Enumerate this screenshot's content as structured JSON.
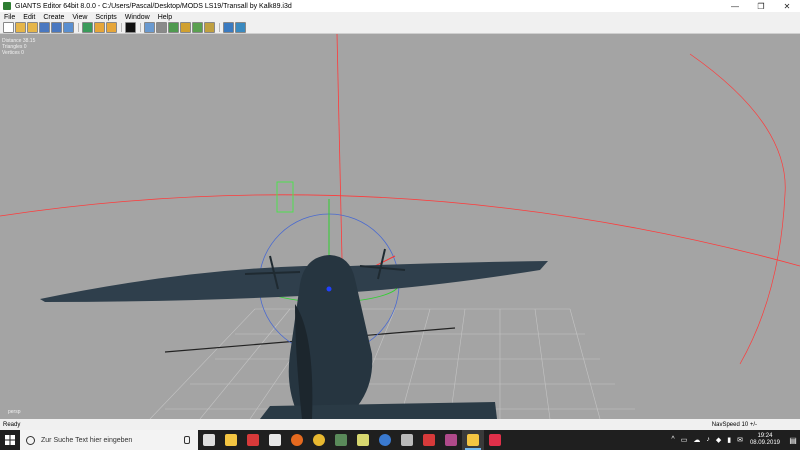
{
  "window": {
    "title": "GIANTS Editor 64bit 8.0.0 - C:/Users/Pascal/Desktop/MODS LS19/Transall by Kalk89.i3d"
  },
  "menu": [
    "File",
    "Edit",
    "Create",
    "View",
    "Scripts",
    "Window",
    "Help"
  ],
  "toolbar_icons": [
    {
      "name": "new-file-icon",
      "color": "#ffffff"
    },
    {
      "name": "open-folder-icon",
      "color": "#e6b64a"
    },
    {
      "name": "open-recent-icon",
      "color": "#e6b64a"
    },
    {
      "name": "save-icon",
      "color": "#4a78c0"
    },
    {
      "name": "save-as-icon",
      "color": "#4a78c0"
    },
    {
      "name": "export-icon",
      "color": "#5a8fd0"
    },
    {
      "name": "refresh-icon",
      "color": "#3a9a5a"
    },
    {
      "name": "undo-icon",
      "color": "#e6a63a"
    },
    {
      "name": "redo-icon",
      "color": "#e6a63a"
    },
    {
      "name": "play-icon",
      "color": "#111111"
    },
    {
      "name": "select-tool-icon",
      "color": "#6a9ad0"
    },
    {
      "name": "move-tool-icon",
      "color": "#8a8a8a"
    },
    {
      "name": "terrain-sculpt-icon",
      "color": "#4f9a4f"
    },
    {
      "name": "terrain-paint-icon",
      "color": "#d0a030"
    },
    {
      "name": "foliage-paint-icon",
      "color": "#5aa050"
    },
    {
      "name": "brush-icon",
      "color": "#c0a040"
    },
    {
      "name": "settings-gear-icon",
      "color": "#3a7ac0"
    },
    {
      "name": "snap-icon",
      "color": "#3a8ac0"
    }
  ],
  "viewport": {
    "stats": [
      "Distance 38.15",
      "Triangles 0",
      "Vertices 0"
    ],
    "camera": "persp"
  },
  "status": {
    "left": "Ready",
    "right": "NavSpeed 10 +/-"
  },
  "taskbar": {
    "search_placeholder": "Zur Suche Text hier eingeben",
    "apps": [
      {
        "name": "task-view-icon",
        "color": "#dddddd"
      },
      {
        "name": "file-explorer-icon",
        "color": "#f4c542"
      },
      {
        "name": "app-red-icon",
        "color": "#d83a3a"
      },
      {
        "name": "store-icon",
        "color": "#e8e8e8"
      },
      {
        "name": "firefox-icon",
        "color": "#e66a1f"
      },
      {
        "name": "chrome-icon",
        "color": "#e8b830"
      },
      {
        "name": "giants-editor-icon",
        "color": "#5a8a5a"
      },
      {
        "name": "notes-icon",
        "color": "#d8d870"
      },
      {
        "name": "app-blue-round-icon",
        "color": "#3a7ad0"
      },
      {
        "name": "app-grey-icon",
        "color": "#bbbbbb"
      },
      {
        "name": "app-red2-icon",
        "color": "#d83a3a"
      },
      {
        "name": "winrar-icon",
        "color": "#b04a8a"
      },
      {
        "name": "active-app-icon",
        "color": "#f4c542"
      },
      {
        "name": "app-pink-icon",
        "color": "#e0304a"
      }
    ],
    "tray_icons": [
      "^",
      "▭",
      "☁",
      "♪",
      "◆",
      "▮",
      "✉"
    ],
    "time": "19:24",
    "date": "08.09.2019"
  }
}
